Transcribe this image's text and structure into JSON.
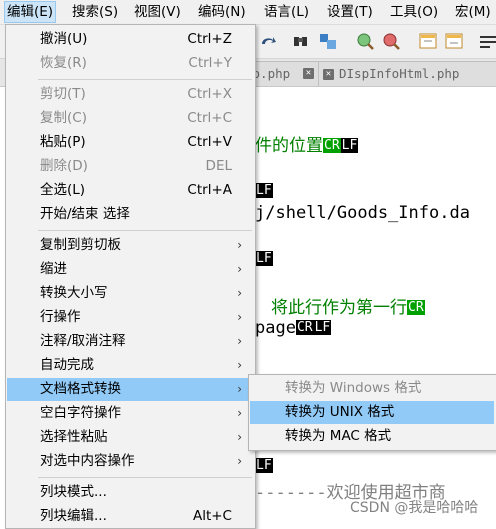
{
  "menubar": {
    "items": [
      {
        "label": "编辑(E)"
      },
      {
        "label": "搜索(S)"
      },
      {
        "label": "视图(V)"
      },
      {
        "label": "编码(N)"
      },
      {
        "label": "语言(L)"
      },
      {
        "label": "设置(T)"
      },
      {
        "label": "工具(O)"
      },
      {
        "label": "宏(M)"
      }
    ]
  },
  "tabs": [
    {
      "label": "fo.php"
    },
    {
      "label": "DIspInfoHtml.php"
    }
  ],
  "editor": {
    "line1": "件的位置",
    "line2": "j/shell/Goods_Info.da",
    "line3": "将此行作为第一行",
    "line4": "page",
    "line5": "-------欢迎使用超市商"
  },
  "eol": {
    "cr": "CR",
    "lf": "LF"
  },
  "edit_menu": {
    "items": [
      {
        "label": "撤消(U)",
        "shortcut": "Ctrl+Z",
        "enabled": true
      },
      {
        "label": "恢复(R)",
        "shortcut": "Ctrl+Y",
        "enabled": false
      },
      {
        "label": "剪切(T)",
        "shortcut": "Ctrl+X",
        "enabled": false
      },
      {
        "label": "复制(C)",
        "shortcut": "Ctrl+C",
        "enabled": false
      },
      {
        "label": "粘贴(P)",
        "shortcut": "Ctrl+V",
        "enabled": true
      },
      {
        "label": "删除(D)",
        "shortcut": "DEL",
        "enabled": false
      },
      {
        "label": "全选(L)",
        "shortcut": "Ctrl+A",
        "enabled": true
      },
      {
        "label": "开始/结束 选择",
        "shortcut": "",
        "enabled": true
      },
      {
        "label": "复制到剪切板",
        "enabled": true
      },
      {
        "label": "缩进",
        "enabled": true
      },
      {
        "label": "转换大小写",
        "enabled": true
      },
      {
        "label": "行操作",
        "enabled": true
      },
      {
        "label": "注释/取消注释",
        "enabled": true
      },
      {
        "label": "自动完成",
        "enabled": true
      },
      {
        "label": "文档格式转换",
        "enabled": true,
        "highlighted": true
      },
      {
        "label": "空白字符操作",
        "enabled": true
      },
      {
        "label": "选择性粘贴",
        "enabled": true
      },
      {
        "label": "对选中内容操作",
        "enabled": true
      },
      {
        "label": "列块模式...",
        "enabled": true
      },
      {
        "label": "列块编辑...",
        "shortcut": "Alt+C",
        "enabled": true
      }
    ]
  },
  "format_submenu": {
    "items": [
      {
        "label": "转换为 Windows 格式",
        "enabled": false
      },
      {
        "label": "转换为 UNIX 格式",
        "enabled": true,
        "highlighted": true
      },
      {
        "label": "转换为 MAC 格式",
        "enabled": true
      }
    ]
  },
  "watermark": "CSDN @我是哈哈哈",
  "colors": {
    "highlight": "#91c9f7",
    "menu_bg": "#f2f2f2",
    "code_green": "#008000"
  }
}
